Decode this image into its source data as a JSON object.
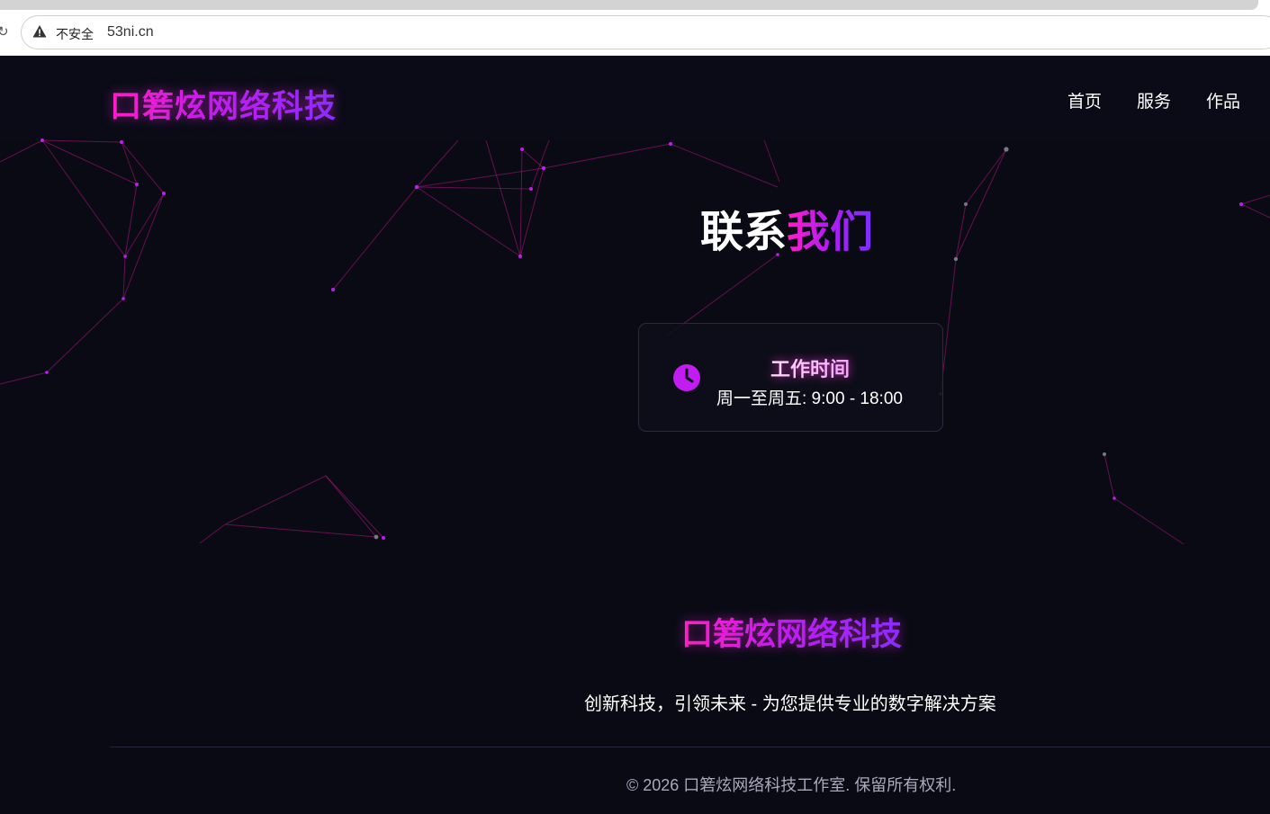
{
  "browser": {
    "security_label": "不安全",
    "url": "53ni.cn"
  },
  "header": {
    "brand": "口箬炫网络科技",
    "nav": [
      "首页",
      "服务",
      "作品"
    ]
  },
  "contact": {
    "title_part1": "联系",
    "title_part2": "我们",
    "hours_title": "工作时间",
    "hours_text": "周一至周五: 9:00 - 18:00",
    "icon": "clock-icon"
  },
  "footer": {
    "brand": "口箬炫网络科技",
    "slogan": "创新科技，引领未来 - 为您提供专业的数字解决方案",
    "copyright": "© 2026 口箬炫网络科技工作室. 保留所有权利."
  },
  "colors": {
    "background": "#0a0a15",
    "accent_pink": "#ff1fc5",
    "accent_purple": "#8a2cff",
    "clock": "#c21cf0"
  }
}
